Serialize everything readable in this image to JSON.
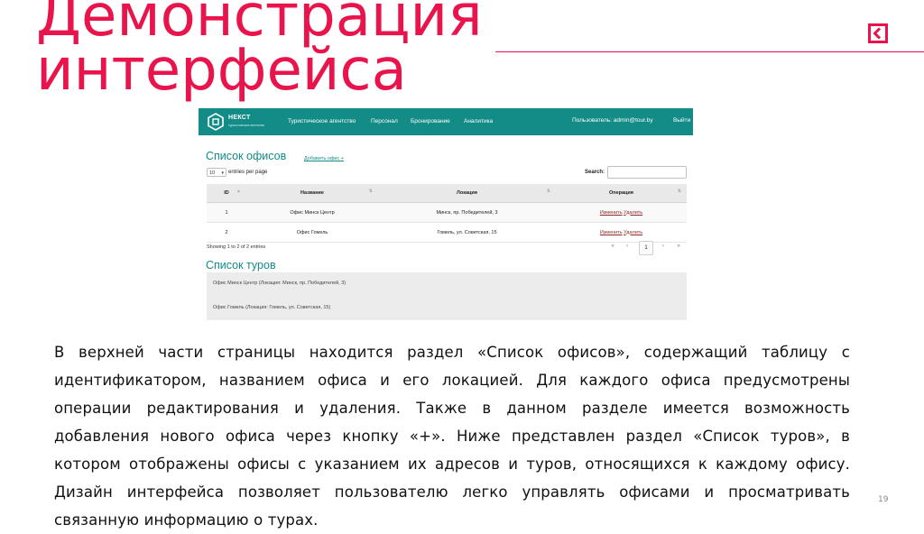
{
  "slide": {
    "title_line1": "Демонстрация",
    "title_line2": "интерфейса",
    "slide_number": "19",
    "back_icon": "back-arrow-icon",
    "accent_color": "#e8144b",
    "body_text": "В верхней части страницы находится раздел «Список офисов», содержащий таблицу с идентификатором, названием офиса и его локацией. Для каждого офиса предусмотрены операции редактирования и удаления. Также в данном разделе имеется возможность добавления нового офиса через кнопку «+». Ниже представлен раздел «Список туров», в котором отображены офисы с указанием их адресов и туров, относящихся к каждому офису. Дизайн интерфейса позволяет пользователю легко управлять офисами и просматривать связанную информацию о турах."
  },
  "app": {
    "brand_color": "#138b86",
    "logo": {
      "name": "НЕКСТ",
      "tagline": "туристическое агентство"
    },
    "nav": [
      {
        "label": "Туристическое агентство"
      },
      {
        "label": "Персонал"
      },
      {
        "label": "Бронирование"
      },
      {
        "label": "Аналитика"
      }
    ],
    "user_label": "Пользователь: admin@tour.by",
    "exit_label": "Выйти",
    "offices": {
      "title": "Список офисов",
      "add_link": "Добавить офис +",
      "length_value": "10",
      "length_label": "entries per page",
      "search_label": "Search:",
      "columns": [
        "ID",
        "Название",
        "Локация",
        "Операция"
      ],
      "rows": [
        {
          "id": "1",
          "name": "Офис Минск Центр",
          "location": "Минск, пр. Победителей, 3",
          "edit": "Изменить",
          "delete": "Удалить"
        },
        {
          "id": "2",
          "name": "Офис Гомель",
          "location": "Гомель, ул. Советская, 15",
          "edit": "Изменить",
          "delete": "Удалить"
        }
      ],
      "info": "Showing 1 to 2 of 2 entries",
      "pagination": {
        "first": "«",
        "prev": "‹",
        "current": "1",
        "next": "›",
        "last": "»"
      }
    },
    "tours": {
      "title": "Список туров",
      "items": [
        "Офис Минск Центр (Локация: Минск, пр. Победителей, 3)",
        "Офис Гомель (Локация: Гомель, ул. Советская, 15)"
      ]
    }
  }
}
